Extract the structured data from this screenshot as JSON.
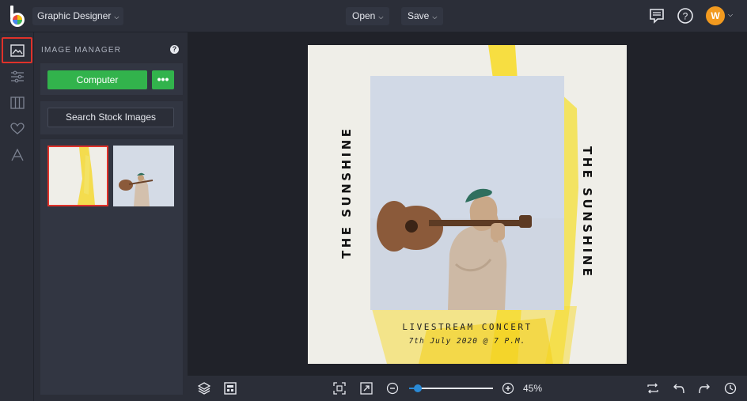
{
  "header": {
    "app_name": "Graphic Designer",
    "open_label": "Open",
    "save_label": "Save",
    "user_initial": "W"
  },
  "image_manager": {
    "title": "IMAGE MANAGER",
    "computer_button": "Computer",
    "more_button": "•••",
    "stock_button": "Search Stock Images"
  },
  "poster": {
    "vertical_title_left": "THE SUNSHINE",
    "vertical_title_right": "THE SUNSHINE",
    "subtitle": "LIVESTREAM CONCERT",
    "date_line": "7th July 2020 @ 7 P.M."
  },
  "footer": {
    "zoom_percent": "45%",
    "zoom_value": 0.1
  },
  "colors": {
    "accent_green": "#32b34c",
    "avatar_orange": "#f29a1f",
    "active_outline": "#e0322a",
    "slider_blue": "#2a8ad6"
  }
}
